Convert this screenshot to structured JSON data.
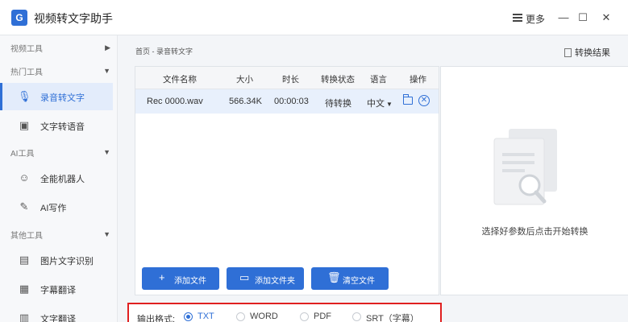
{
  "app": {
    "title": "视频转文字助手",
    "logo_text": "G"
  },
  "titlebar": {
    "more_label": "更多",
    "minimize": "—",
    "maximize": "☐",
    "close": "✕"
  },
  "sidebar": {
    "sections": [
      {
        "title": "视频工具"
      },
      {
        "title": "热门工具"
      },
      {
        "title": "AI工具"
      },
      {
        "title": "其他工具"
      }
    ],
    "items": [
      {
        "label": "录音转文字",
        "icon": "microphone-icon"
      },
      {
        "label": "文字转语音",
        "icon": "text-to-speech-icon"
      },
      {
        "label": "全能机器人",
        "icon": "robot-icon"
      },
      {
        "label": "AI写作",
        "icon": "ai-writing-icon"
      },
      {
        "label": "图片文字识别",
        "icon": "image-ocr-icon"
      },
      {
        "label": "字幕翻译",
        "icon": "subtitle-translate-icon"
      },
      {
        "label": "文字翻译",
        "icon": "text-translate-icon"
      }
    ]
  },
  "breadcrumb": {
    "home": "首页",
    "separator": "-",
    "current": "录音转文字"
  },
  "result_link": "转换结果",
  "table": {
    "headers": [
      "文件名称",
      "大小",
      "时长",
      "转换状态",
      "语言",
      "操作"
    ],
    "rows": [
      {
        "name": "Rec 0000.wav",
        "size": "566.34K",
        "duration": "00:00:03",
        "status": "待转换",
        "language": "中文"
      }
    ]
  },
  "buttons": {
    "add_file": "添加文件",
    "add_folder": "添加文件夹",
    "clear": "清空文件"
  },
  "preview": {
    "hint": "选择好参数后点击开始转换"
  },
  "output_format": {
    "label": "输出格式:",
    "options": [
      "TXT",
      "WORD",
      "PDF",
      "SRT（字幕）"
    ],
    "selected": "TXT"
  }
}
